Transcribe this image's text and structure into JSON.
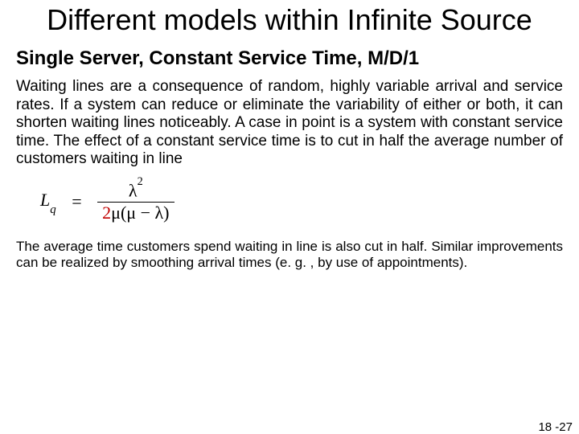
{
  "title": "Different models within Infinite Source",
  "subhead": "Single Server, Constant Service Time, M/D/1",
  "paragraph1": "Waiting lines are a consequence of random, highly variable arrival and service rates. If a system can reduce or eliminate the variability of either or both, it can shorten waiting lines noticeably. A case in point is a system with constant service time. The effect of a constant service time is to cut in half the average number of customers waiting in line",
  "formula": {
    "lhs_var": "L",
    "lhs_sub": "q",
    "numerator_sym": "λ",
    "numerator_exp": "2",
    "denominator_factor": "2",
    "denominator_mu": "μ",
    "denominator_diff_mu": "μ",
    "denominator_diff_lambda": "λ"
  },
  "paragraph2": "The average time customers spend waiting in line is also cut in half. Similar improvements can be realized by smoothing arrival times (e. g. , by use of appointments).",
  "pagenum": "18 -27"
}
